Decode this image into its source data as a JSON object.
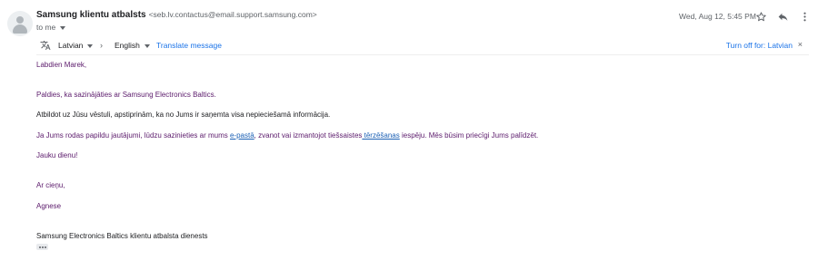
{
  "header": {
    "sender_name": "Samsung klientu atbalsts",
    "sender_email": "<seb.lv.contactus@email.support.samsung.com>",
    "recipient": "to me",
    "date": "Wed, Aug 12, 5:45 PM"
  },
  "icons": {
    "avatar": "avatar-icon",
    "star": "star-icon",
    "reply": "reply-icon",
    "more": "more-vert-icon",
    "translate": "translate-icon",
    "close": "close-icon"
  },
  "translate_bar": {
    "from_language": "Latvian",
    "arrow": "›",
    "to_language": "English",
    "translate_link": "Translate message",
    "turn_off_link": "Turn off for: Latvian",
    "close": "×"
  },
  "message": {
    "greeting": "Labdien Marek,",
    "thanks": "Paldies, ka sazinājāties ar Samsung Electronics Baltics.",
    "reply_confirm": "Atbildot uz Jūsu vēstuli, apstiprinām, ka no Jums ir saņemta visa nepieciešamā informācija.",
    "questions_part1": "Ja Jums rodas papildu jautājumi, lūdzu sazinieties ar mums ",
    "email_link": "e-pastā",
    "questions_part2": ", zvanot vai izmantojot tiešsaistes",
    "chat_link": " tērzēšanas",
    "questions_part3": " iespēju. Mēs būsim  priecīgi Jums palīdzēt.",
    "nice_day": "Jauku dienu!",
    "regards": "Ar cieņu,",
    "agent": "Agnese",
    "signature": "Samsung Electronics Baltics klientu atbalsta dienests"
  },
  "colors": {
    "message_text": "#5b1a6b",
    "link": "#1a73e8"
  }
}
